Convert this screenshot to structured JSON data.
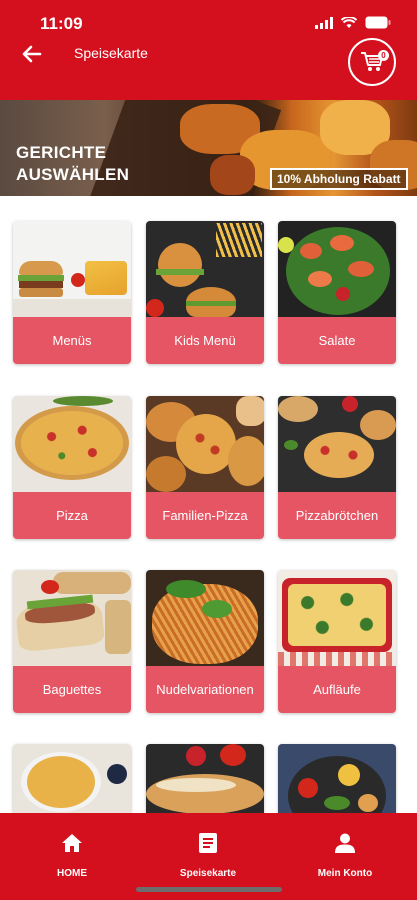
{
  "status_bar": {
    "time": "11:09"
  },
  "header": {
    "title": "Speisekarte",
    "cart_count": "0"
  },
  "banner": {
    "heading_line1": "GERICHTE",
    "heading_line2": "AUSWÄHLEN",
    "promo": "10% Abholung Rabatt"
  },
  "categories": [
    {
      "label": "Menüs"
    },
    {
      "label": "Kids Menü"
    },
    {
      "label": "Salate"
    },
    {
      "label": "Pizza"
    },
    {
      "label": "Familien-Pizza"
    },
    {
      "label": "Pizzabrötchen"
    },
    {
      "label": "Baguettes"
    },
    {
      "label": "Nudelvariationen"
    },
    {
      "label": "Aufläufe"
    }
  ],
  "bottom_nav": {
    "home": "HOME",
    "menu": "Speisekarte",
    "account": "Mein Konto"
  },
  "colors": {
    "brand_red": "#d4101f",
    "card_label": "#e55563"
  }
}
